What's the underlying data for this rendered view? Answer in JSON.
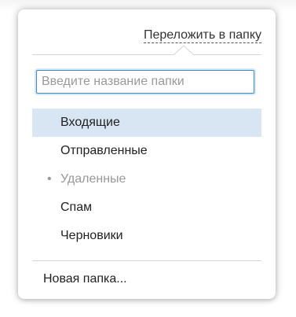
{
  "header": {
    "move_to_folder_label": "Переложить в папку"
  },
  "search": {
    "placeholder": "Введите название папки",
    "value": ""
  },
  "folders": [
    {
      "label": "Входящие",
      "selected": true
    },
    {
      "label": "Отправленные"
    },
    {
      "label": "Удаленные",
      "disabled": true
    },
    {
      "label": "Спам"
    },
    {
      "label": "Черновики"
    }
  ],
  "footer": {
    "new_folder_label": "Новая папка..."
  },
  "colors": {
    "selected_row": "#d8e5f3",
    "focus_border": "#3b8cd9",
    "disabled_text": "#999999"
  },
  "icons": {
    "bullet": "•"
  }
}
